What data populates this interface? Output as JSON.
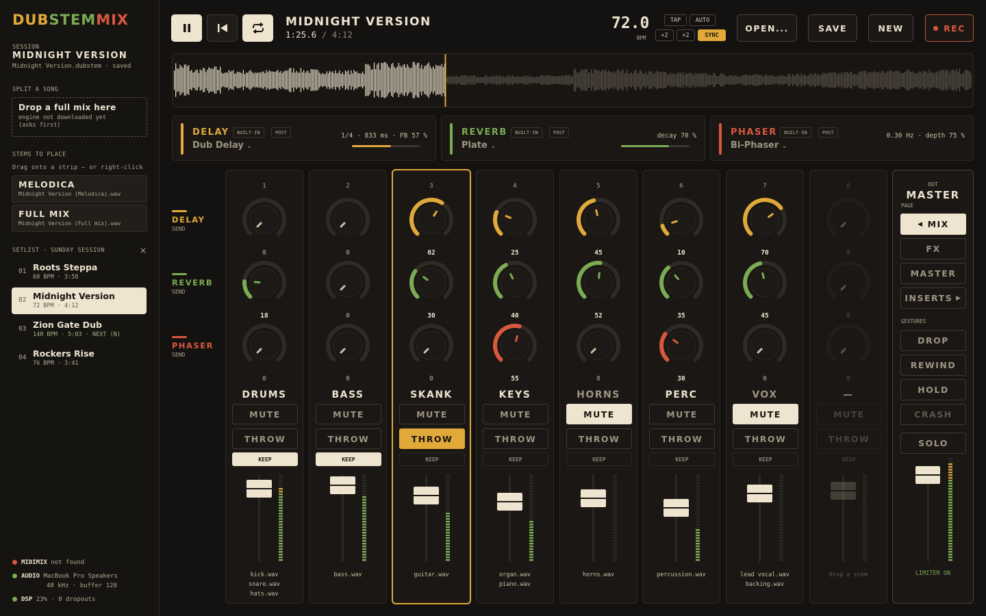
{
  "app": {
    "logo": "DUBSTEMMIX",
    "logo_parts": [
      {
        "text": "DUB",
        "color": "#e0a93a"
      },
      {
        "text": "STEM",
        "color": "#7bab53"
      },
      {
        "text": "MIX",
        "color": "#d9573f"
      }
    ]
  },
  "sidebar": {
    "session_label": "SESSION",
    "session_name": "MIDNIGHT VERSION",
    "session_file": "Midnight Version.dubstem · saved",
    "split_label": "SPLIT A SONG",
    "drop_title": "Drop a full mix here",
    "drop_sub1": "engine not downloaded yet",
    "drop_sub2": "(asks first)",
    "stems_label": "STEMS TO PLACE",
    "stems_hint": "Drag onto a strip — or right-click",
    "stems": [
      {
        "name": "MELODICA",
        "file": "Midnight Version (Melodica).wav"
      },
      {
        "name": "FULL MIX",
        "file": "Midnight Version (Full mix).wav"
      }
    ],
    "setlist_label": "SETLIST · SUNDAY SESSION",
    "setlist_close": "×",
    "setlist": [
      {
        "num": "01",
        "title": "Roots Steppa",
        "meta": "68 BPM · 3:58"
      },
      {
        "num": "02",
        "title": "Midnight Version",
        "meta": "72 BPM · 4:12",
        "active": true
      },
      {
        "num": "03",
        "title": "Zion Gate Dub",
        "meta": "140 BPM · 5:03 · NEXT (N)"
      },
      {
        "num": "04",
        "title": "Rockers Rise",
        "meta": "76 BPM · 3:41"
      }
    ],
    "status": [
      {
        "label": "MIDIMIX",
        "text": "not found",
        "color": "#d9573f"
      },
      {
        "label": "AUDIO",
        "text": "MacBook Pro Speakers",
        "text2": "48 kHz · buffer 128",
        "color": "#7bab53"
      },
      {
        "label": "DSP",
        "text": "23% · 0 dropouts",
        "color": "#7bab53"
      }
    ]
  },
  "transport": {
    "title": "MIDNIGHT VERSION",
    "position": "1:25.6",
    "sep": "/",
    "duration": "4:12",
    "playhead_fraction": 0.34,
    "bpm": "72.0",
    "bpm_unit": "BPM",
    "tap": "TAP",
    "auto": "AUTO",
    "half": "÷2",
    "double": "×2",
    "sync": "SYNC",
    "open": "OPEN...",
    "save": "SAVE",
    "new": "NEW",
    "rec": "REC"
  },
  "fx": [
    {
      "name": "DELAY",
      "color": "#e0a93a",
      "tag1": "BUILT-IN",
      "tag2": "POST",
      "preset": "Dub Delay",
      "params": "1/4 · 833 ms · FB 57 %",
      "level": 0.57
    },
    {
      "name": "REVERB",
      "color": "#7bab53",
      "tag1": "BUILT-IN",
      "tag2": "POST",
      "preset": "Plate",
      "params": "decay 70 %",
      "level": 0.7
    },
    {
      "name": "PHASER",
      "color": "#d9573f",
      "tag1": "BUILT-IN",
      "tag2": "POST",
      "preset": "Bi-Phaser",
      "params": "0.30 Hz · depth 75 %",
      "level": 0.75
    }
  ],
  "sends": [
    {
      "name": "DELAY",
      "sub": "SEND",
      "color": "#e0a93a"
    },
    {
      "name": "REVERB",
      "sub": "SEND",
      "color": "#7bab53"
    },
    {
      "name": "PHASER",
      "sub": "SEND",
      "color": "#d9573f"
    }
  ],
  "strips": [
    {
      "num": "1",
      "delay": 0,
      "reverb": 18,
      "phaser": 0,
      "name": "DRUMS",
      "mute": "MUTE",
      "throw": "THROW",
      "keep": "KEEP",
      "muted": false,
      "throwing": false,
      "kept": true,
      "fader": 0.78,
      "meter": 0.85,
      "files": [
        "kick.wav",
        "snare.wav",
        "hats.wav"
      ]
    },
    {
      "num": "2",
      "delay": 0,
      "reverb": 0,
      "phaser": 0,
      "name": "BASS",
      "mute": "MUTE",
      "throw": "THROW",
      "keep": "KEEP",
      "muted": false,
      "throwing": false,
      "kept": true,
      "fader": 0.82,
      "meter": 0.75,
      "files": [
        "bass.wav"
      ]
    },
    {
      "num": "3",
      "delay": 62,
      "reverb": 30,
      "phaser": 0,
      "name": "SKANK",
      "mute": "MUTE",
      "throw": "THROW",
      "keep": "KEEP",
      "muted": false,
      "throwing": true,
      "kept": false,
      "fader": 0.7,
      "meter": 0.58,
      "files": [
        "guitar.wav"
      ],
      "selected": true
    },
    {
      "num": "4",
      "delay": 25,
      "reverb": 40,
      "phaser": 55,
      "name": "KEYS",
      "mute": "MUTE",
      "throw": "THROW",
      "keep": "KEEP",
      "muted": false,
      "throwing": false,
      "kept": false,
      "fader": 0.63,
      "meter": 0.48,
      "files": [
        "organ.wav",
        "piano.wav"
      ]
    },
    {
      "num": "5",
      "delay": 45,
      "reverb": 52,
      "phaser": 0,
      "name": "HORNS",
      "mute": "MUTE",
      "throw": "THROW",
      "keep": "KEEP",
      "muted": true,
      "throwing": false,
      "kept": false,
      "fader": 0.67,
      "meter": 0.0,
      "files": [
        "horns.wav"
      ],
      "dim_name": true
    },
    {
      "num": "6",
      "delay": 10,
      "reverb": 35,
      "phaser": 30,
      "name": "PERC",
      "mute": "MUTE",
      "throw": "THROW",
      "keep": "KEEP",
      "muted": false,
      "throwing": false,
      "kept": false,
      "fader": 0.56,
      "meter": 0.4,
      "files": [
        "percussion.wav"
      ]
    },
    {
      "num": "7",
      "delay": 70,
      "reverb": 45,
      "phaser": 0,
      "name": "VOX",
      "mute": "MUTE",
      "throw": "THROW",
      "keep": "KEEP",
      "muted": true,
      "throwing": false,
      "kept": false,
      "fader": 0.73,
      "meter": 0.0,
      "files": [
        "lead vocal.wav",
        "backing.wav"
      ],
      "dim_name": true
    },
    {
      "num": "8",
      "delay": 0,
      "reverb": 0,
      "phaser": 0,
      "name": "—",
      "mute": "MUTE",
      "throw": "THROW",
      "keep": "KEEP",
      "muted": false,
      "throwing": false,
      "kept": false,
      "fader": 0.76,
      "meter": 0.0,
      "files": [
        "drop a stem"
      ],
      "empty": true
    }
  ],
  "master": {
    "out": "OUT",
    "title": "MASTER",
    "page": "PAGE",
    "mix": "MIX",
    "fx": "FX",
    "master": "MASTER",
    "inserts": "INSERTS",
    "gestures": "GESTURES",
    "drop": "DROP",
    "rewind": "REWIND",
    "hold": "HOLD",
    "crash": "CRASH",
    "solo": "SOLO",
    "limiter": "LIMITER ON",
    "fader": 0.88,
    "meter": 0.95
  },
  "colors": {
    "amber": "#e0a93a",
    "green": "#7bab53",
    "red": "#d9573f",
    "cream": "#efe4cf"
  }
}
